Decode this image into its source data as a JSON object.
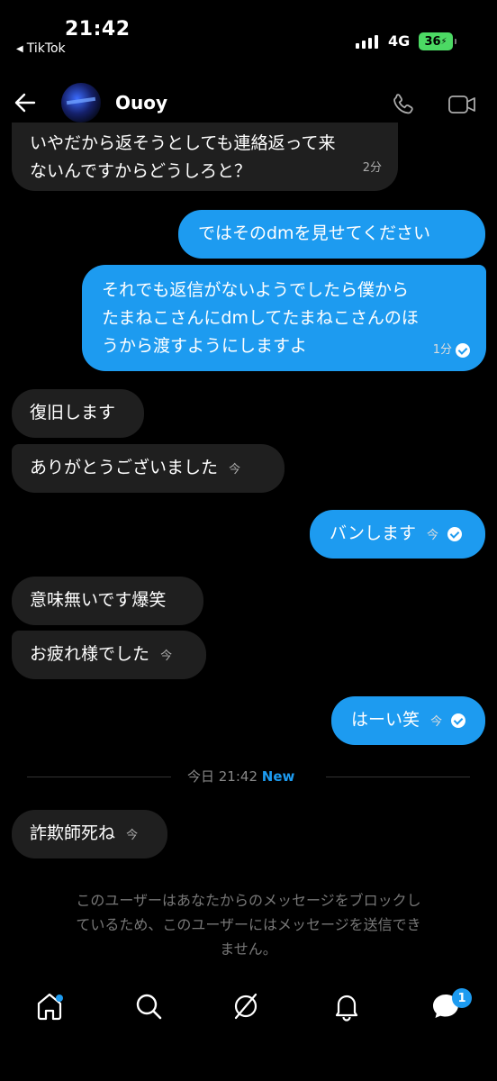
{
  "status_bar": {
    "time": "21:42",
    "back_app": "TikTok",
    "network": "4G",
    "battery": "36"
  },
  "header": {
    "username": "Ouoy"
  },
  "messages": [
    {
      "side": "recv",
      "text_lines": [
        "いやだから返そうとしても連絡返って来",
        "ないんですからどうしろと？"
      ],
      "time": "2分"
    },
    {
      "side": "sent",
      "text_lines": [
        "ではそのdmを見せてください"
      ],
      "time": ""
    },
    {
      "side": "sent",
      "text_lines": [
        "それでも返信がないようでしたら僕から",
        "たまねこさんにdmしてたまねこさんのほ",
        "うから渡すようにしますよ"
      ],
      "time": "1分"
    },
    {
      "side": "recv",
      "text_lines": [
        "復旧します"
      ],
      "time": ""
    },
    {
      "side": "recv",
      "text_lines": [
        "ありがとうございました"
      ],
      "time": "今"
    },
    {
      "side": "sent",
      "text_lines": [
        "バンします"
      ],
      "time": "今"
    },
    {
      "side": "recv",
      "text_lines": [
        "意味無いです爆笑"
      ],
      "time": ""
    },
    {
      "side": "recv",
      "text_lines": [
        "お疲れ様でした"
      ],
      "time": "今"
    },
    {
      "side": "sent",
      "text_lines": [
        "はーい笑"
      ],
      "time": "今"
    },
    {
      "side": "recv",
      "text_lines": [
        "詐欺師死ね"
      ],
      "time": "今"
    }
  ],
  "divider": {
    "time": "今日 21:42",
    "label": "New"
  },
  "notice": {
    "line1": "このユーザーはあなたからのメッセージをブロックし",
    "line2": "ているため、このユーザーにはメッセージを送信でき",
    "line3": "ません。"
  },
  "nav": {
    "inbox_badge": "1",
    "items": [
      "home-icon",
      "search-icon",
      "explore-icon",
      "notifications-icon",
      "messages-icon"
    ]
  },
  "colors": {
    "accent": "#1d9bf0",
    "received_bubble": "#1f1f1f",
    "background": "#000000"
  }
}
